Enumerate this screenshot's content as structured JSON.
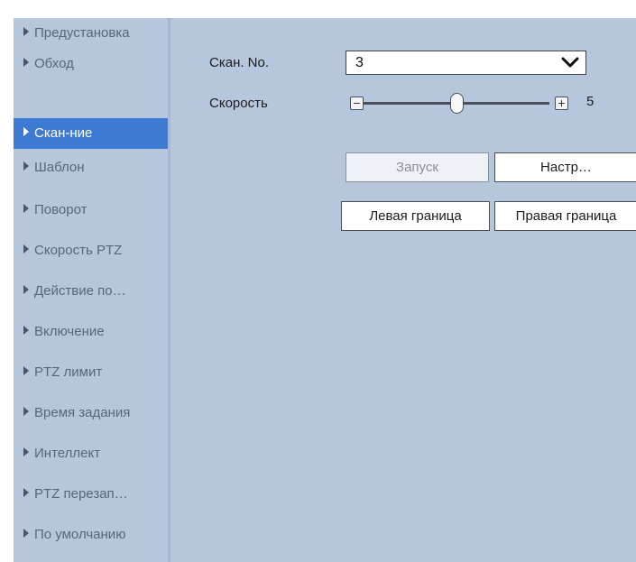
{
  "sidebar": {
    "items": [
      {
        "label": "Предустановка",
        "active": false
      },
      {
        "label": "Обход",
        "active": false
      },
      {
        "label": "Скан-ние",
        "active": true
      },
      {
        "label": "Шаблон",
        "active": false
      },
      {
        "label": "Поворот",
        "active": false
      },
      {
        "label": "Скорость PTZ",
        "active": false
      },
      {
        "label": "Действие по…",
        "active": false
      },
      {
        "label": "Включение",
        "active": false
      },
      {
        "label": "PTZ лимит",
        "active": false
      },
      {
        "label": "Время задания",
        "active": false
      },
      {
        "label": "Интеллект",
        "active": false
      },
      {
        "label": "PTZ перезап…",
        "active": false
      },
      {
        "label": "По умолчанию",
        "active": false
      }
    ]
  },
  "scan": {
    "number_label": "Скан. No.",
    "number_value": "3",
    "speed_label": "Скорость",
    "speed_value": "5",
    "speed_level": 0.5,
    "decrease_glyph": "−",
    "increase_glyph": "+"
  },
  "buttons": {
    "start": {
      "label": "Запуск",
      "enabled": false
    },
    "settings": {
      "label": "Настр…",
      "enabled": true
    },
    "left_limit": {
      "label": "Левая граница",
      "enabled": true
    },
    "right_limit": {
      "label": "Правая граница",
      "enabled": true
    }
  },
  "colors": {
    "panel_bg": "#b6c6dc",
    "active_item_bg": "#3c7ad3",
    "active_item_text": "#ffffff",
    "inactive_item_text": "#5a6678"
  },
  "icons": {
    "nav_bullet": "triangle-right-icon",
    "dropdown": "chevron-down-icon"
  }
}
